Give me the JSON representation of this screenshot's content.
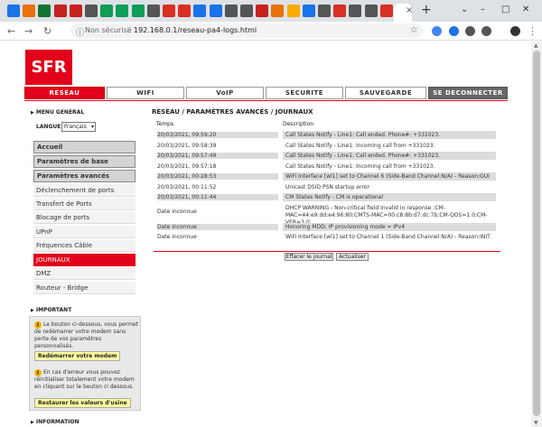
{
  "browser": {
    "tab_close": "×",
    "new_tab": "+",
    "address": {
      "security_label": "Non sécurisé",
      "separator": "|",
      "url": "192.168.0.1/reseau-pa4-logs.html"
    },
    "tab_colors": [
      "#1a73e8",
      "#e8710a",
      "#137333",
      "#c5221f",
      "#c5221f",
      "#555555",
      "#0f9d58",
      "#0f9d58",
      "#0f9d58",
      "#555555",
      "#d93025",
      "#d93025",
      "#1a73e8",
      "#1a73e8",
      "#555555",
      "#555555",
      "#c5221f",
      "#e8710a",
      "#f9ab00",
      "#1a73e8",
      "#555555",
      "#d93025",
      "#555555",
      "#555555",
      "#d93025"
    ],
    "ext_colors": [
      "#4285f4",
      "#1a73e8",
      "#555555",
      "#555555",
      "#333333"
    ]
  },
  "page": {
    "logo": "SFR",
    "nav": [
      "RESEAU",
      "WIFI",
      "VoIP",
      "SECURITE",
      "SAUVEGARDE",
      "SE DECONNECTER"
    ],
    "sidebar": {
      "menu_general": "MENU GENERAL",
      "lang_label": "LANGUE",
      "lang_value": "Français",
      "items": [
        {
          "label": "Accueil",
          "kind": "head"
        },
        {
          "label": "Paramètres de base",
          "kind": "head"
        },
        {
          "label": "Paramètres avancés",
          "kind": "head"
        },
        {
          "label": "Déclenchement de ports",
          "kind": "sub"
        },
        {
          "label": "Transfert de Ports",
          "kind": "sub"
        },
        {
          "label": "Blocage de ports",
          "kind": "sub"
        },
        {
          "label": "UPnP",
          "kind": "sub"
        },
        {
          "label": "Fréquences Câble",
          "kind": "sub"
        },
        {
          "label": "JOURNAUX",
          "kind": "active"
        },
        {
          "label": "DMZ",
          "kind": "sub"
        },
        {
          "label": "Routeur - Bridge",
          "kind": "sub"
        }
      ],
      "important": "IMPORTANT",
      "imp_text1": "Le bouton ci-dessous, vous permet de redémarrer votre modem sans perte de vos paramètres personnalisés.",
      "restart_btn": "Redémarrer votre modem",
      "imp_text2": "En cas d'erreur vous pouvez réinitialiser totalement votre modem en cliquant sur le bouton ci dessous.",
      "restore_btn": "Restaurer les valeurs d'usine",
      "information": "INFORMATION",
      "warn_glyph": "!"
    },
    "main": {
      "breadcrumb": "RESEAU / PARAMÈTRES AVANCÉS / JOURNAUX",
      "col_time": "Temps",
      "col_desc": "Description",
      "rows": [
        {
          "time": "20/03/2021, 09:59:20",
          "desc": "Call States Notify - Line1: Call ended. Phone#: +331023.",
          "shade": true
        },
        {
          "time": "20/03/2021, 09:58:39",
          "desc": "Call States Notify - Line1: Incoming call from +331023.",
          "shade": false
        },
        {
          "time": "20/03/2021, 09:57:49",
          "desc": "Call States Notify - Line1: Call ended. Phone#: +331023.",
          "shade": true
        },
        {
          "time": "20/03/2021, 09:57:18",
          "desc": "Call States Notify - Line1: Incoming call from +331023.",
          "shade": false
        },
        {
          "time": "20/03/2021, 00:28:53",
          "desc": "WiFi Interface [wl1] set to Channel 6 (Side-Band Channel:N/A) - Reason:GUI",
          "shade": true
        },
        {
          "time": "20/03/2021, 00:11:52",
          "desc": "Unicast DSID PSN startup error",
          "shade": false
        },
        {
          "time": "20/03/2021, 00:11:44",
          "desc": "CM States Notify - CM is operational",
          "shade": true
        },
        {
          "time": "Date inconnue",
          "desc": "DHCP WARNING - Non-critical field invalid in response ;CM-MAC=44:e9:dd:e4:96:80;CMTS-MAC=00:c8:8b:d7:dc:7b;CM-QOS=1.0;CM-VER=3.0;",
          "shade": false,
          "tall": true
        },
        {
          "time": "Date inconnue",
          "desc": "Honoring MDD; IP provisioning mode = IPv4",
          "shade": true
        },
        {
          "time": "Date inconnue",
          "desc": "WiFi Interface [wl1] set to Channel 1 (Side-Band Channel:N/A) - Reason:INIT",
          "shade": false
        }
      ],
      "clear_btn": "Effacer le journal",
      "refresh_btn": "Actualiser"
    }
  }
}
